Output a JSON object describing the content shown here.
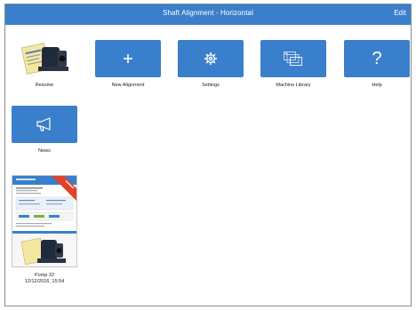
{
  "header": {
    "title": "Shaft Alignment - Horizontal",
    "edit_label": "Edit"
  },
  "tiles": {
    "resume": "Resume",
    "new_alignment": "New Alignment",
    "settings": "Settings",
    "machine_library": "Machine Library",
    "help": "Help",
    "news": "News"
  },
  "report": {
    "name": "Pump 32",
    "timestamp": "12/12/2016, 15:54"
  },
  "colors": {
    "accent": "#3a7fcb",
    "ribbon": "#e0432a"
  },
  "icons": {
    "new_alignment": "plus-icon",
    "settings": "gear-icon",
    "machine_library": "stacked-windows-icon",
    "help": "question-mark-icon",
    "news": "megaphone-icon"
  }
}
